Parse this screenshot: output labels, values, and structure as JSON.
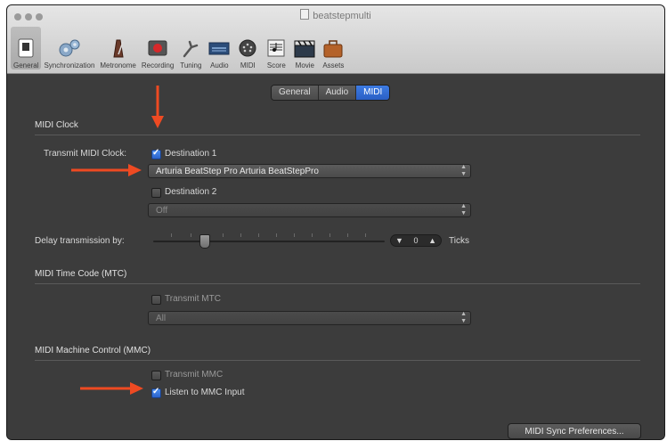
{
  "window": {
    "title": "beatstepmulti"
  },
  "toolbar": {
    "items": [
      {
        "label": "General",
        "icon": "general-icon"
      },
      {
        "label": "Synchronization",
        "icon": "gears-icon"
      },
      {
        "label": "Metronome",
        "icon": "metronome-icon"
      },
      {
        "label": "Recording",
        "icon": "record-icon"
      },
      {
        "label": "Tuning",
        "icon": "tuning-fork-icon"
      },
      {
        "label": "Audio",
        "icon": "audio-icon"
      },
      {
        "label": "MIDI",
        "icon": "midi-icon"
      },
      {
        "label": "Score",
        "icon": "score-icon"
      },
      {
        "label": "Movie",
        "icon": "movie-icon"
      },
      {
        "label": "Assets",
        "icon": "assets-icon"
      }
    ]
  },
  "tabs": {
    "items": [
      "General",
      "Audio",
      "MIDI"
    ],
    "active": "MIDI"
  },
  "midi_clock": {
    "section_title": "MIDI Clock",
    "transmit_label": "Transmit MIDI Clock:",
    "destination1_label": "Destination 1",
    "destination1_checked": true,
    "destination1_value": "Arturia BeatStep Pro Arturia BeatStepPro",
    "destination2_label": "Destination 2",
    "destination2_checked": false,
    "destination2_value": "Off",
    "delay_label": "Delay transmission by:",
    "delay_value": "0",
    "delay_unit": "Ticks"
  },
  "mtc": {
    "section_title": "MIDI Time Code (MTC)",
    "transmit_label": "Transmit MTC",
    "transmit_checked": false,
    "destination_value": "All"
  },
  "mmc": {
    "section_title": "MIDI Machine Control (MMC)",
    "transmit_label": "Transmit MMC",
    "transmit_checked": false,
    "listen_label": "Listen to MMC Input",
    "listen_checked": true
  },
  "footer": {
    "sync_prefs_button": "MIDI Sync Preferences..."
  },
  "colors": {
    "annotation_arrow": "#ee4a22",
    "accent_blue": "#2a63cc",
    "panel_bg": "#3c3c3c"
  }
}
